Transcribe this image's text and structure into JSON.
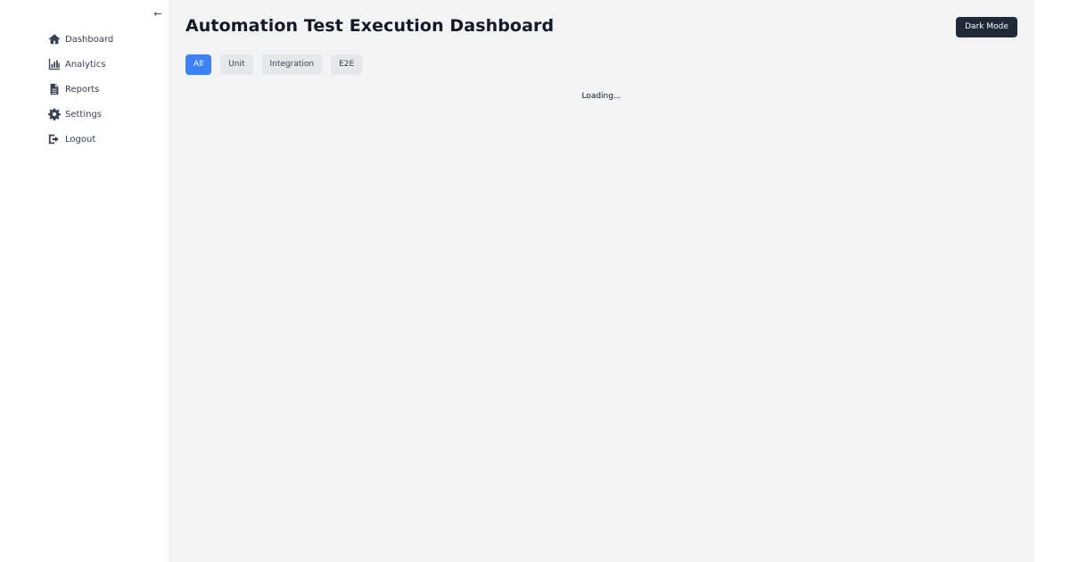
{
  "sidebar": {
    "collapse_icon": "←",
    "items": [
      {
        "label": "Dashboard",
        "icon": "home-icon"
      },
      {
        "label": "Analytics",
        "icon": "bar-chart-icon"
      },
      {
        "label": "Reports",
        "icon": "document-icon"
      },
      {
        "label": "Settings",
        "icon": "gear-icon"
      },
      {
        "label": "Logout",
        "icon": "logout-icon"
      }
    ]
  },
  "header": {
    "title": "Automation Test Execution Dashboard",
    "dark_mode_label": "Dark Mode"
  },
  "filters": {
    "active": "All",
    "items": [
      "All",
      "Unit",
      "Integration",
      "E2E"
    ]
  },
  "main": {
    "status": "Loading..."
  },
  "colors": {
    "accent": "#3b82f6",
    "dark_button": "#1f2937",
    "main_background": "#f2f3f5",
    "filter_inactive": "#e5e7eb"
  }
}
